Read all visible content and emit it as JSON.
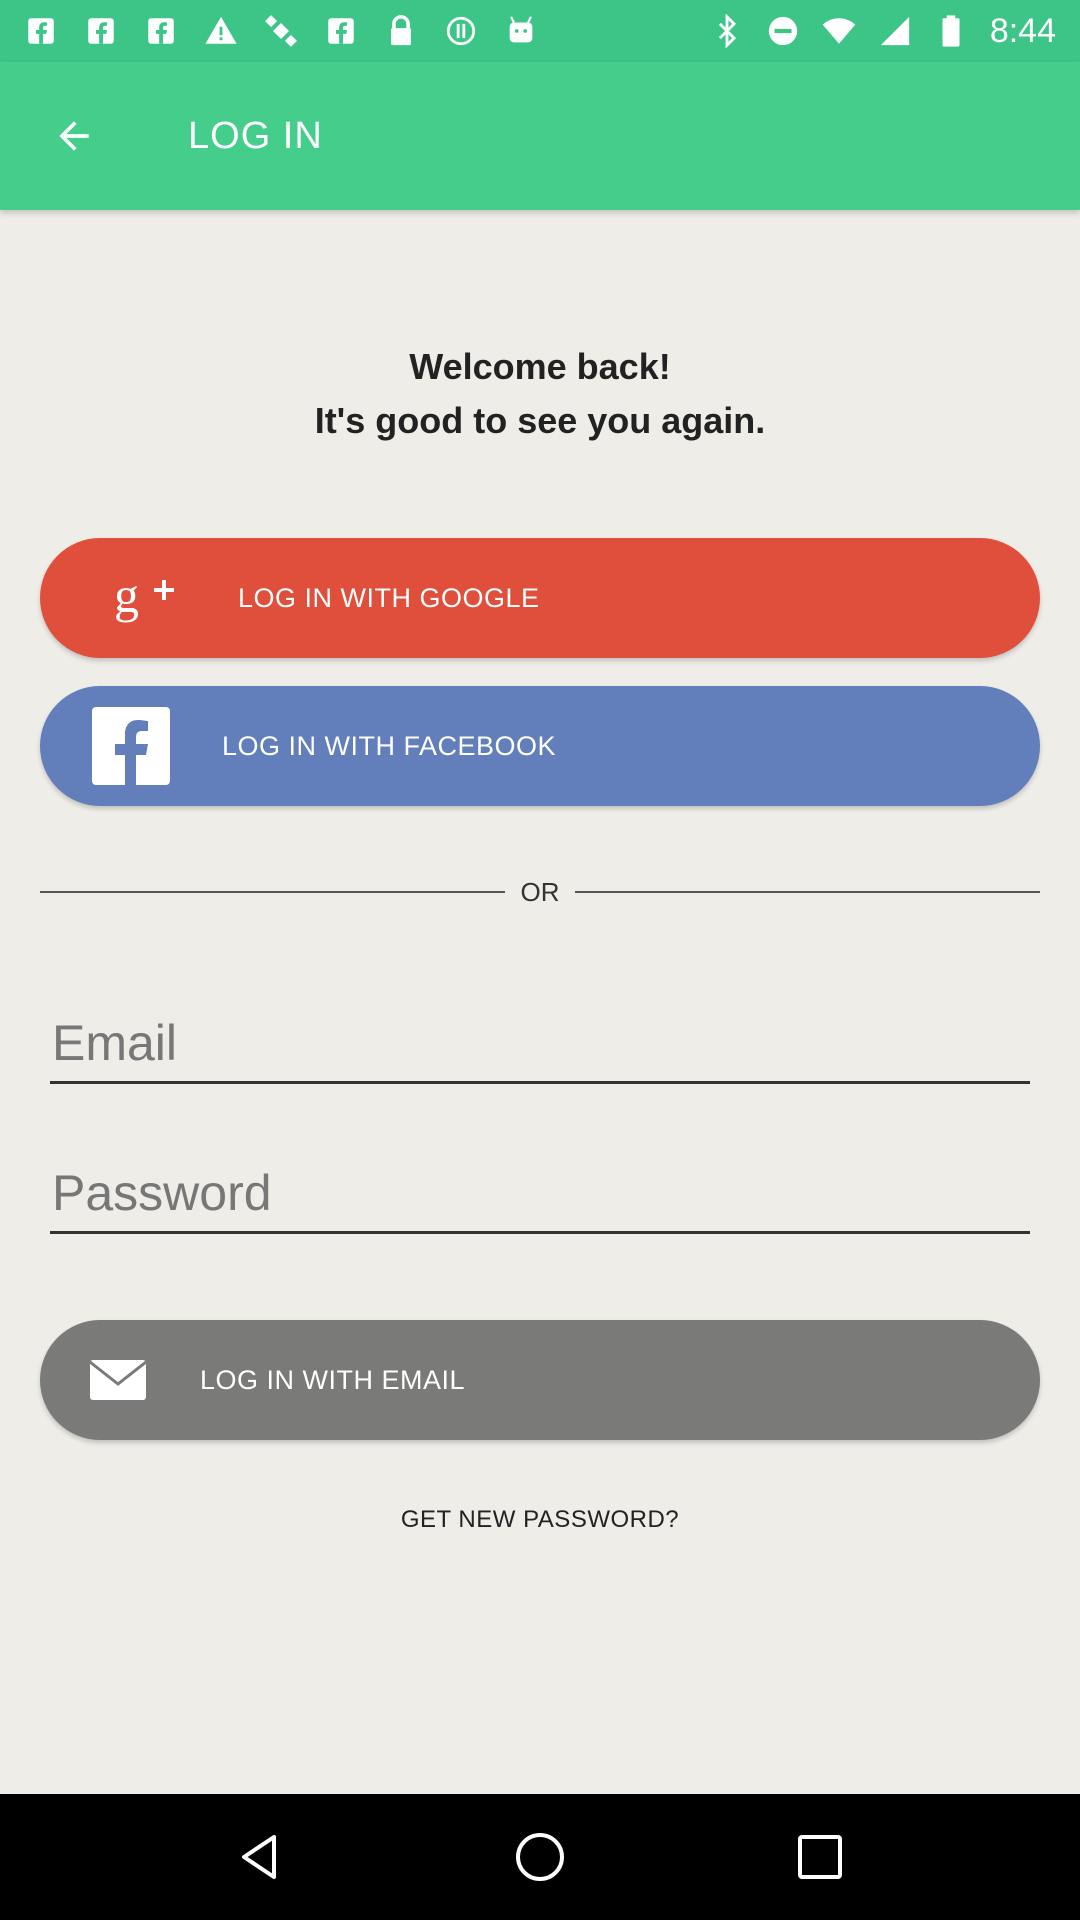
{
  "status_bar": {
    "time": "8:44",
    "left_icons": [
      "fb-notification-icon",
      "fb-notification-icon",
      "fb-notification-icon",
      "warning-icon",
      "satellite-icon",
      "fb-notification-icon",
      "lock-icon",
      "sync-icon",
      "android-icon"
    ],
    "right_icons": [
      "bluetooth-icon",
      "do-not-disturb-icon",
      "wifi-icon",
      "signal-icon",
      "battery-icon"
    ]
  },
  "app_bar": {
    "title": "LOG IN",
    "back_icon": "arrow-back-icon"
  },
  "welcome": {
    "line1": "Welcome back!",
    "line2": "It's good to see you again."
  },
  "buttons": {
    "google": {
      "label": "LOG IN WITH GOOGLE",
      "icon": "google-plus-icon",
      "color": "#df4f3b"
    },
    "facebook": {
      "label": "LOG IN WITH FACEBOOK",
      "icon": "facebook-icon",
      "color": "#627ebb"
    },
    "email": {
      "label": "LOG IN WITH EMAIL",
      "icon": "mail-icon",
      "color": "#7a7a78"
    }
  },
  "divider": {
    "text": "OR"
  },
  "fields": {
    "email": {
      "placeholder": "Email",
      "value": ""
    },
    "password": {
      "placeholder": "Password",
      "value": ""
    }
  },
  "links": {
    "get_new_password": "GET NEW PASSWORD?"
  },
  "colors": {
    "status_bar": "#3cc587",
    "app_bar": "#45cd8c",
    "background": "#efede8"
  },
  "nav_bar": {
    "icons": [
      "back-triangle-icon",
      "home-circle-icon",
      "recents-square-icon"
    ]
  }
}
